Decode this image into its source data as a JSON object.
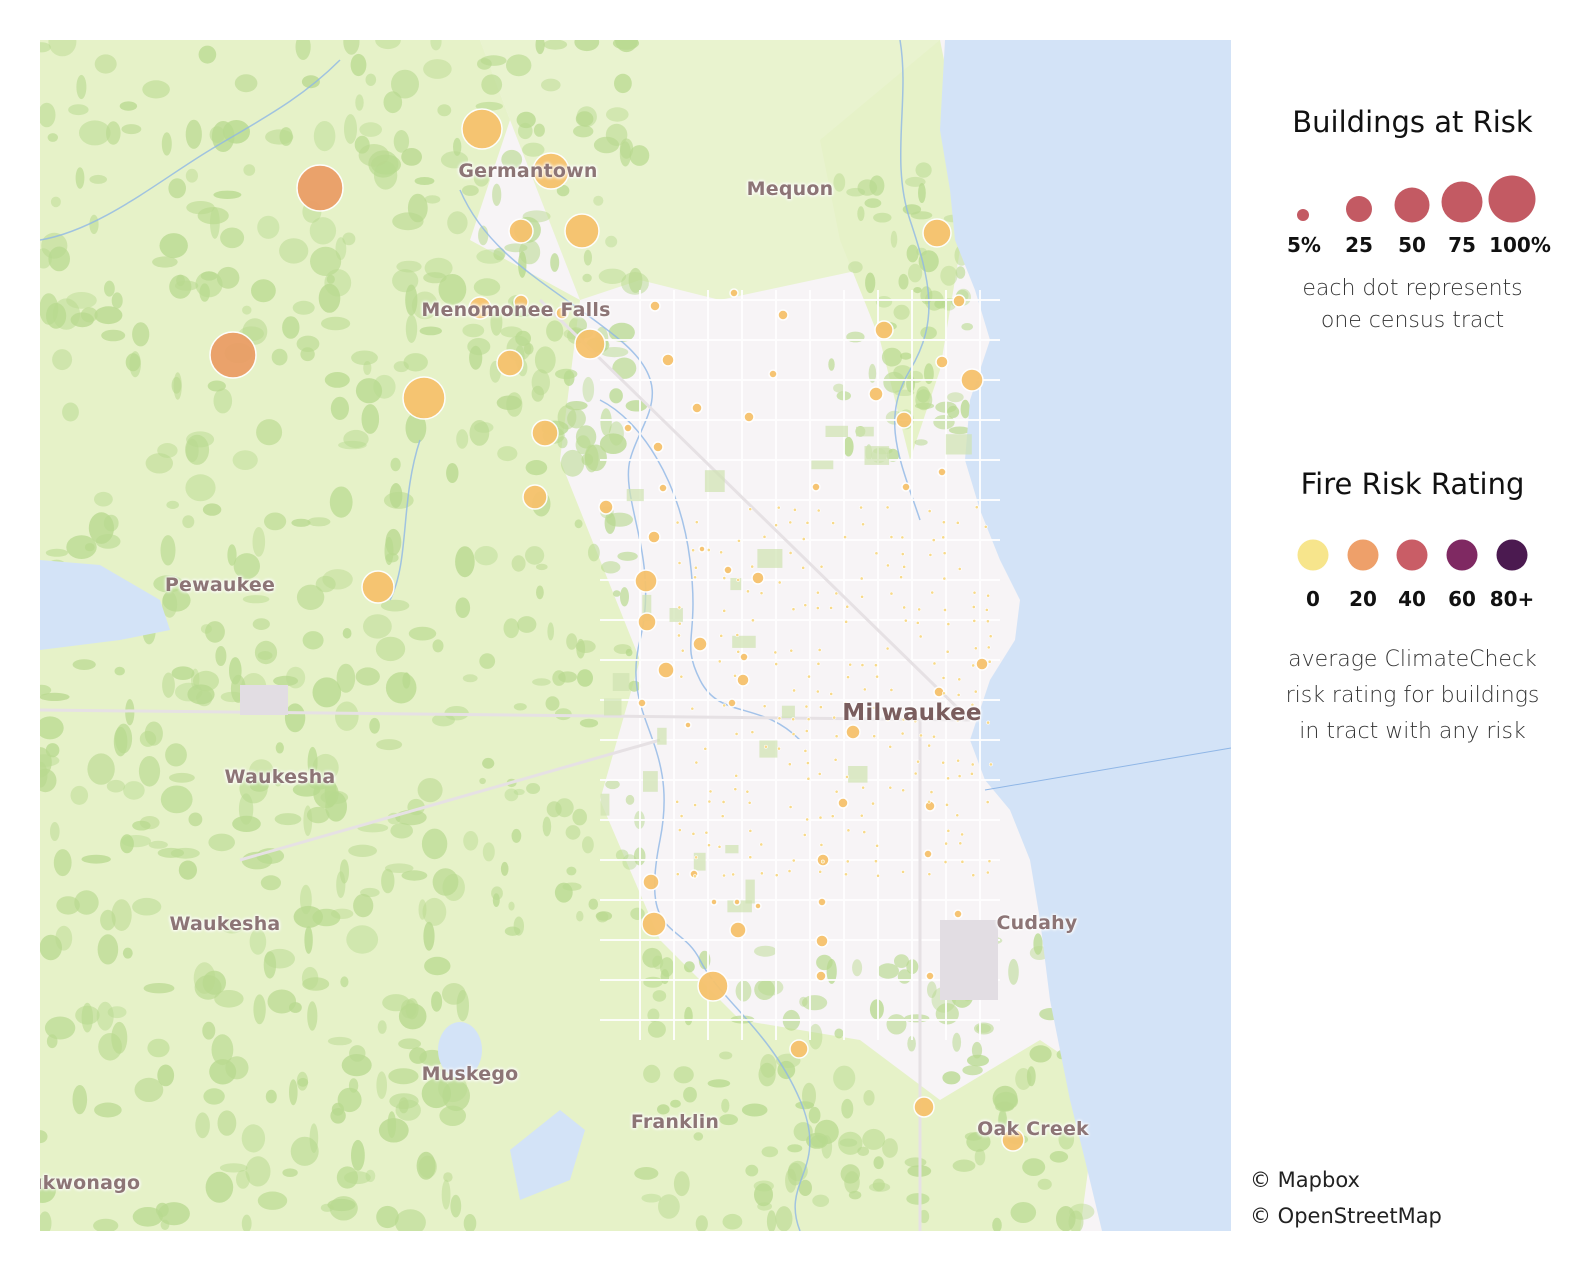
{
  "map": {
    "places": [
      {
        "name": "Germantown",
        "kind": "town"
      },
      {
        "name": "Mequon",
        "kind": "town"
      },
      {
        "name": "Menomonee Falls",
        "kind": "town"
      },
      {
        "name": "Pewaukee",
        "kind": "town"
      },
      {
        "name": "Waukesha",
        "kind": "town"
      },
      {
        "name": "Waukesha",
        "kind": "town"
      },
      {
        "name": "Milwaukee",
        "kind": "city"
      },
      {
        "name": "Cudahy",
        "kind": "town"
      },
      {
        "name": "Muskego",
        "kind": "town"
      },
      {
        "name": "Franklin",
        "kind": "town"
      },
      {
        "name": "Oak Creek",
        "kind": "town"
      },
      {
        "name": "Mukwonago",
        "kind": "town"
      }
    ],
    "water_color": "#d3e3f7",
    "land_color": "#f7f4f6",
    "vegetation_color": "#e6f2c8",
    "forest_color": "#b8d98f"
  },
  "size_legend": {
    "title": "Buildings at Risk",
    "steps": [
      "5%",
      "25",
      "50",
      "75",
      "100%"
    ],
    "color": "#c35a63",
    "note_lines": [
      "each dot represents",
      "one census tract"
    ]
  },
  "color_legend": {
    "title": "Fire Risk Rating",
    "steps": [
      {
        "label": "0",
        "color": "#f7e58c"
      },
      {
        "label": "20",
        "color": "#eea06a"
      },
      {
        "label": "40",
        "color": "#c95d66"
      },
      {
        "label": "60",
        "color": "#7f2962"
      },
      {
        "label": "80+",
        "color": "#4b1a50"
      }
    ],
    "note_lines": [
      "average ClimateCheck",
      "risk rating for buildings",
      "in tract with any risk"
    ]
  },
  "attribution": [
    "© Mapbox",
    "© OpenStreetMap"
  ]
}
